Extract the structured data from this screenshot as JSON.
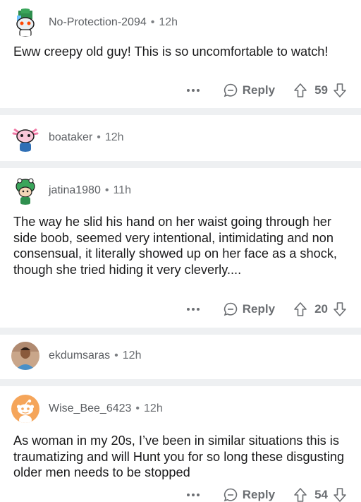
{
  "comments": [
    {
      "username": "No-Protection-2094",
      "age": "12h",
      "text": "Eww creepy old guy! This is so uncomfortable to watch!",
      "reply_label": "Reply",
      "votes": "59"
    },
    {
      "username": "boataker",
      "age": "12h"
    },
    {
      "username": "jatina1980",
      "age": "11h",
      "text": "The way he slid his hand on her waist going through her side boob, seemed very intentional, intimidating and non consensual, it literally showed up on her face as a shock, though she tried hiding it very cleverly....",
      "reply_label": "Reply",
      "votes": "20"
    },
    {
      "username": "ekdumsaras",
      "age": "12h"
    },
    {
      "username": "Wise_Bee_6423",
      "age": "12h",
      "text": "As woman in my 20s, I’ve been in similar situations this is traumatizing and will Hunt you for so long these disgusting older men needs to be stopped",
      "reply_label": "Reply",
      "votes": "54"
    }
  ],
  "separator": "•",
  "colors": {
    "divider": "#eef0f2",
    "meta_text": "#6b6e72",
    "body_text": "#1a1a1b",
    "avatar_orange": "#f5a55a"
  },
  "icons": [
    "more-icon",
    "reply-bubble-icon",
    "upvote-icon",
    "downvote-icon"
  ]
}
